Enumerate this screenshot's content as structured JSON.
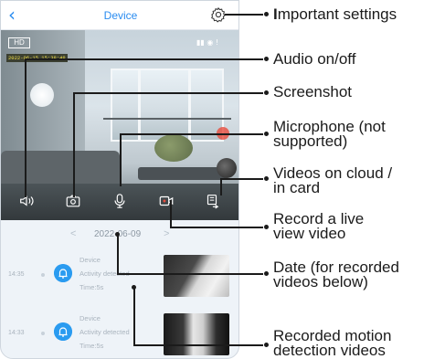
{
  "screen": {
    "title": "Device",
    "nav": {
      "back_icon": "chevron-left-icon",
      "settings_icon": "gear-icon"
    },
    "live_view": {
      "quality_label": "HD",
      "status_icons": "▮▮ ◉ !",
      "timestamp": "2022-06-15 15:38:48",
      "controls": [
        "speaker-icon",
        "camera-icon",
        "microphone-icon",
        "video-record-icon",
        "cloud-card-icon"
      ]
    },
    "date_bar": {
      "prev": "<",
      "date": "2022-06-09",
      "next": ">"
    },
    "events": [
      {
        "time": "14:35",
        "device": "Device",
        "event": "Activity detected",
        "duration": "Time:5s"
      },
      {
        "time": "14:33",
        "device": "Device",
        "event": "Activity detected",
        "duration": "Time:5s"
      }
    ]
  },
  "callouts": [
    {
      "first": "I",
      "rest": "mportant settings"
    },
    {
      "lines": [
        "Audio on/off"
      ]
    },
    {
      "lines": [
        "Screenshot"
      ]
    },
    {
      "lines": [
        "Microphone (not",
        "supported)"
      ]
    },
    {
      "lines": [
        "Videos on cloud /",
        "in card"
      ]
    },
    {
      "lines": [
        "Record a live",
        "view video"
      ]
    },
    {
      "lines": [
        "Date (for recorded",
        "videos below)"
      ]
    },
    {
      "lines": [
        "Recorded motion",
        "detection videos"
      ]
    }
  ],
  "colors": {
    "accent": "#2a8cf0",
    "badge": "#2a9bf0",
    "line": "#1b1b1b"
  }
}
